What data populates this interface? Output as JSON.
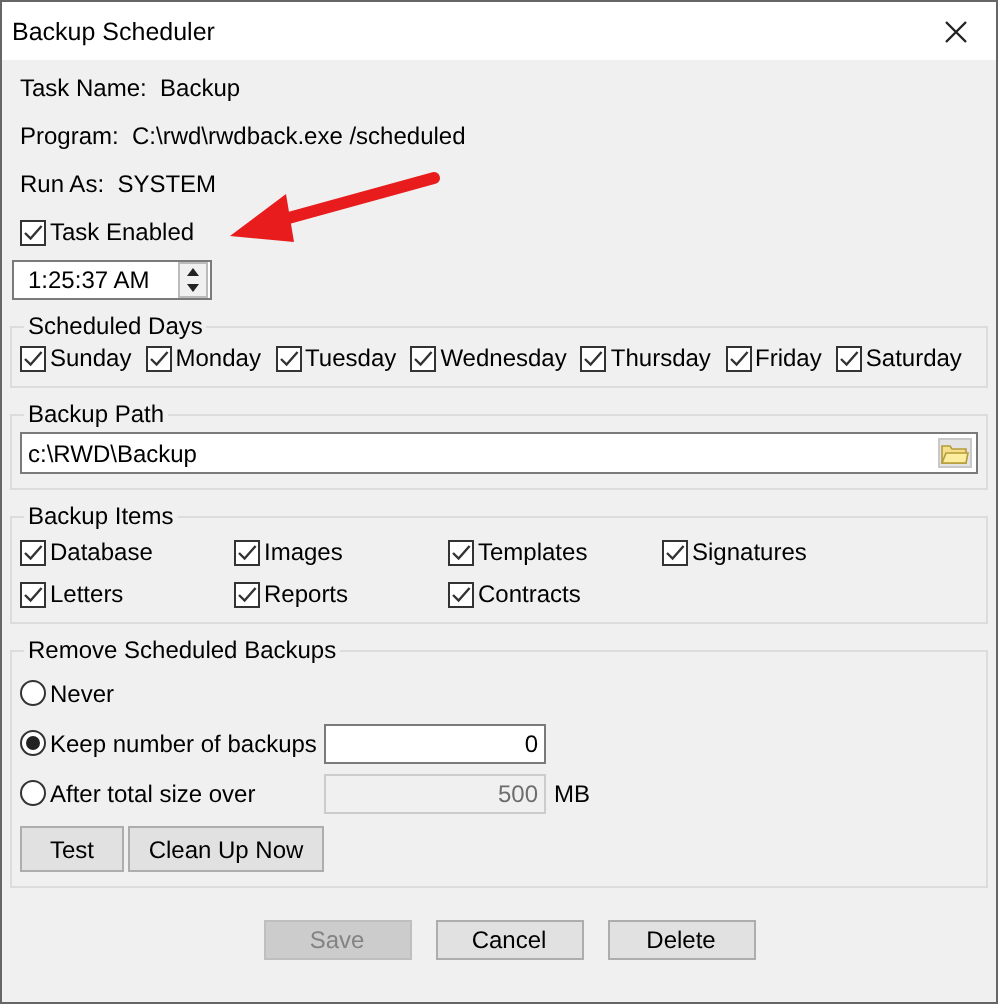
{
  "window": {
    "title": "Backup Scheduler"
  },
  "info": [
    {
      "label": "Task Name:",
      "value": "Backup"
    },
    {
      "label": "Program:",
      "value": "C:\\rwd\\rwdback.exe /scheduled"
    },
    {
      "label": "Run As:",
      "value": "SYSTEM"
    }
  ],
  "task_enabled": {
    "label": "Task Enabled",
    "checked": true
  },
  "time": {
    "value": "1:25:37 AM"
  },
  "scheduled_days": {
    "title": "Scheduled Days",
    "days": [
      {
        "label": "Sunday",
        "checked": true
      },
      {
        "label": "Monday",
        "checked": true
      },
      {
        "label": "Tuesday",
        "checked": true
      },
      {
        "label": "Wednesday",
        "checked": true
      },
      {
        "label": "Thursday",
        "checked": true
      },
      {
        "label": "Friday",
        "checked": true
      },
      {
        "label": "Saturday",
        "checked": true
      }
    ]
  },
  "backup_path": {
    "title": "Backup Path",
    "value": "c:\\RWD\\Backup"
  },
  "backup_items": {
    "title": "Backup Items",
    "items": [
      {
        "label": "Database",
        "checked": true
      },
      {
        "label": "Images",
        "checked": true
      },
      {
        "label": "Templates",
        "checked": true
      },
      {
        "label": "Signatures",
        "checked": true
      },
      {
        "label": "Letters",
        "checked": true
      },
      {
        "label": "Reports",
        "checked": true
      },
      {
        "label": "Contracts",
        "checked": true
      }
    ]
  },
  "remove": {
    "title": "Remove Scheduled Backups",
    "options": [
      {
        "kind": "plain",
        "label": "Never",
        "selected": false
      },
      {
        "kind": "field",
        "label": "Keep number of backups",
        "selected": true,
        "value": "0",
        "disabled": false
      },
      {
        "kind": "field",
        "label": "After total size over",
        "selected": false,
        "value": "500",
        "unit": "MB",
        "disabled": true
      }
    ],
    "buttons": [
      {
        "label": "Test"
      },
      {
        "label": "Clean Up Now"
      }
    ]
  },
  "buttons": [
    {
      "label": "Save",
      "disabled": true
    },
    {
      "label": "Cancel",
      "disabled": false
    },
    {
      "label": "Delete",
      "disabled": false
    }
  ]
}
